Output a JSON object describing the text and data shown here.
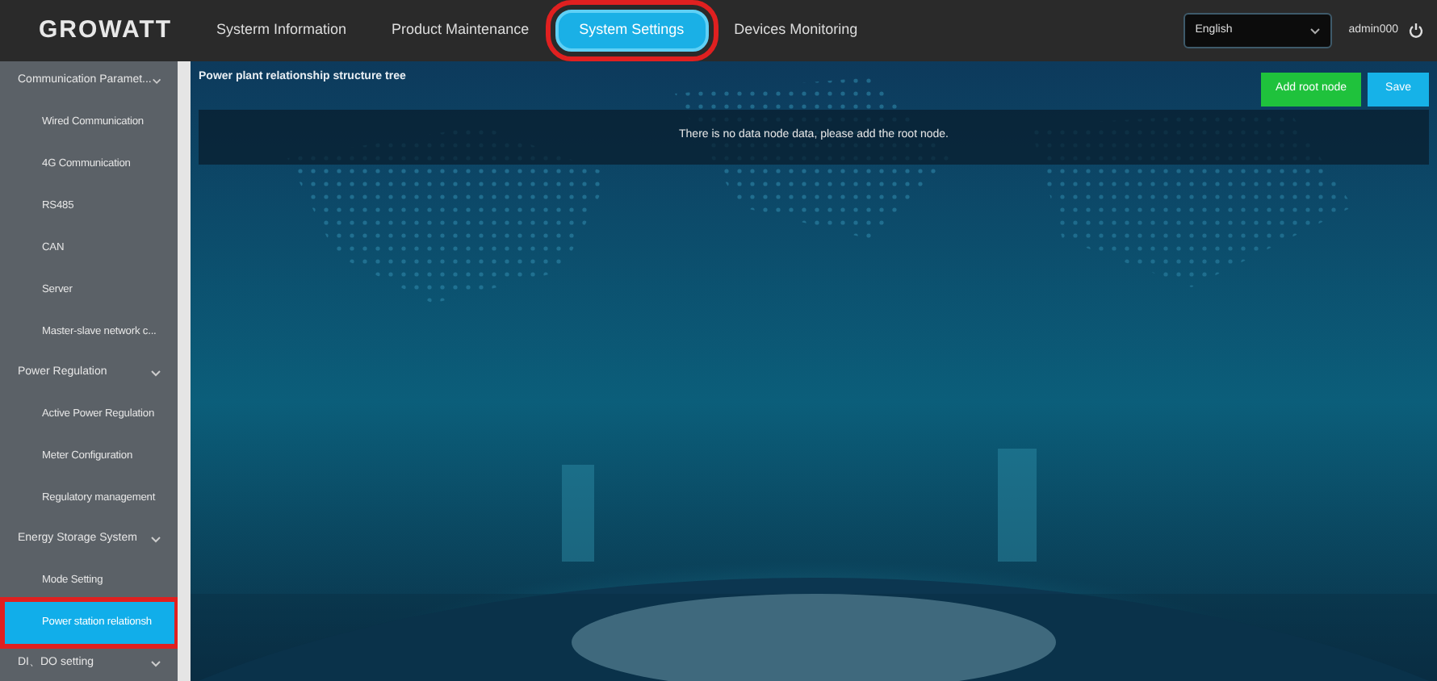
{
  "header": {
    "logo": "GROWATT",
    "nav": [
      {
        "label": "Systerm Information",
        "selected": false,
        "highlighted": false
      },
      {
        "label": "Product Maintenance",
        "selected": false,
        "highlighted": false
      },
      {
        "label": "System Settings",
        "selected": true,
        "highlighted": true
      },
      {
        "label": "Devices Monitoring",
        "selected": false,
        "highlighted": false
      }
    ],
    "language": "English",
    "user": "admin000"
  },
  "sidebar": {
    "groups": [
      {
        "label": "Communication Paramet...",
        "expanded": true,
        "children": [
          {
            "label": "Wired Communication",
            "selected": false,
            "highlighted": false
          },
          {
            "label": "4G Communication",
            "selected": false,
            "highlighted": false
          },
          {
            "label": "RS485",
            "selected": false,
            "highlighted": false
          },
          {
            "label": "CAN",
            "selected": false,
            "highlighted": false
          },
          {
            "label": "Server",
            "selected": false,
            "highlighted": false
          },
          {
            "label": "Master-slave network c...",
            "selected": false,
            "highlighted": false
          }
        ]
      },
      {
        "label": "Power Regulation",
        "expanded": true,
        "children": [
          {
            "label": "Active Power Regulation",
            "selected": false,
            "highlighted": false
          },
          {
            "label": "Meter Configuration",
            "selected": false,
            "highlighted": false
          },
          {
            "label": "Regulatory management",
            "selected": false,
            "highlighted": false
          }
        ]
      },
      {
        "label": "Energy Storage System",
        "expanded": true,
        "children": [
          {
            "label": "Mode Setting",
            "selected": false,
            "highlighted": false
          },
          {
            "label": "Power station relationsh",
            "selected": true,
            "highlighted": true
          }
        ]
      },
      {
        "label": "DI、DO setting",
        "expanded": true
      }
    ]
  },
  "main": {
    "title": "Power plant relationship structure tree",
    "buttons": [
      {
        "label": "Add root node",
        "kind": "add"
      },
      {
        "label": "Save",
        "kind": "save"
      }
    ],
    "empty_message": "There is no data node data, please add the root node."
  }
}
